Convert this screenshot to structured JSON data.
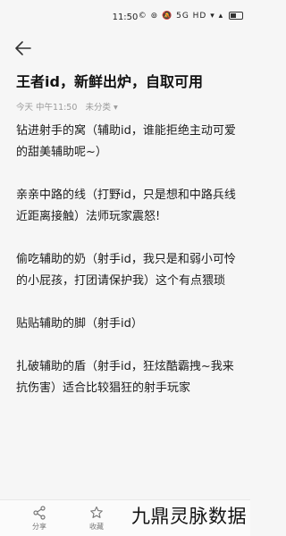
{
  "status_bar": {
    "time": "11:50",
    "icons": "© ⊚ 🔕 5G HD ▾ ▴"
  },
  "note": {
    "title": "王者id，新鲜出炉，自取可用",
    "date": "今天 中午11:50",
    "category": "未分类 ▾",
    "paragraphs": [
      "钻进射手的窝（辅助id，谁能拒绝主动可爱的甜美辅助呢~）",
      "亲亲中路的线（打野id，只是想和中路兵线近距离接触）法师玩家震怒!",
      "偷吃辅助的奶（射手id，我只是和弱小可怜的小屁孩，打团请保护我）这个有点猥琐",
      "贴贴辅助的脚（射手id）",
      "扎破辅助的盾（射手id，狂炫酷霸拽~我来抗伤害）适合比较猖狂的射手玩家"
    ]
  },
  "bottom_bar": {
    "share_label": "分享",
    "favorite_label": "收藏"
  },
  "watermark": "九鼎灵脉数据"
}
